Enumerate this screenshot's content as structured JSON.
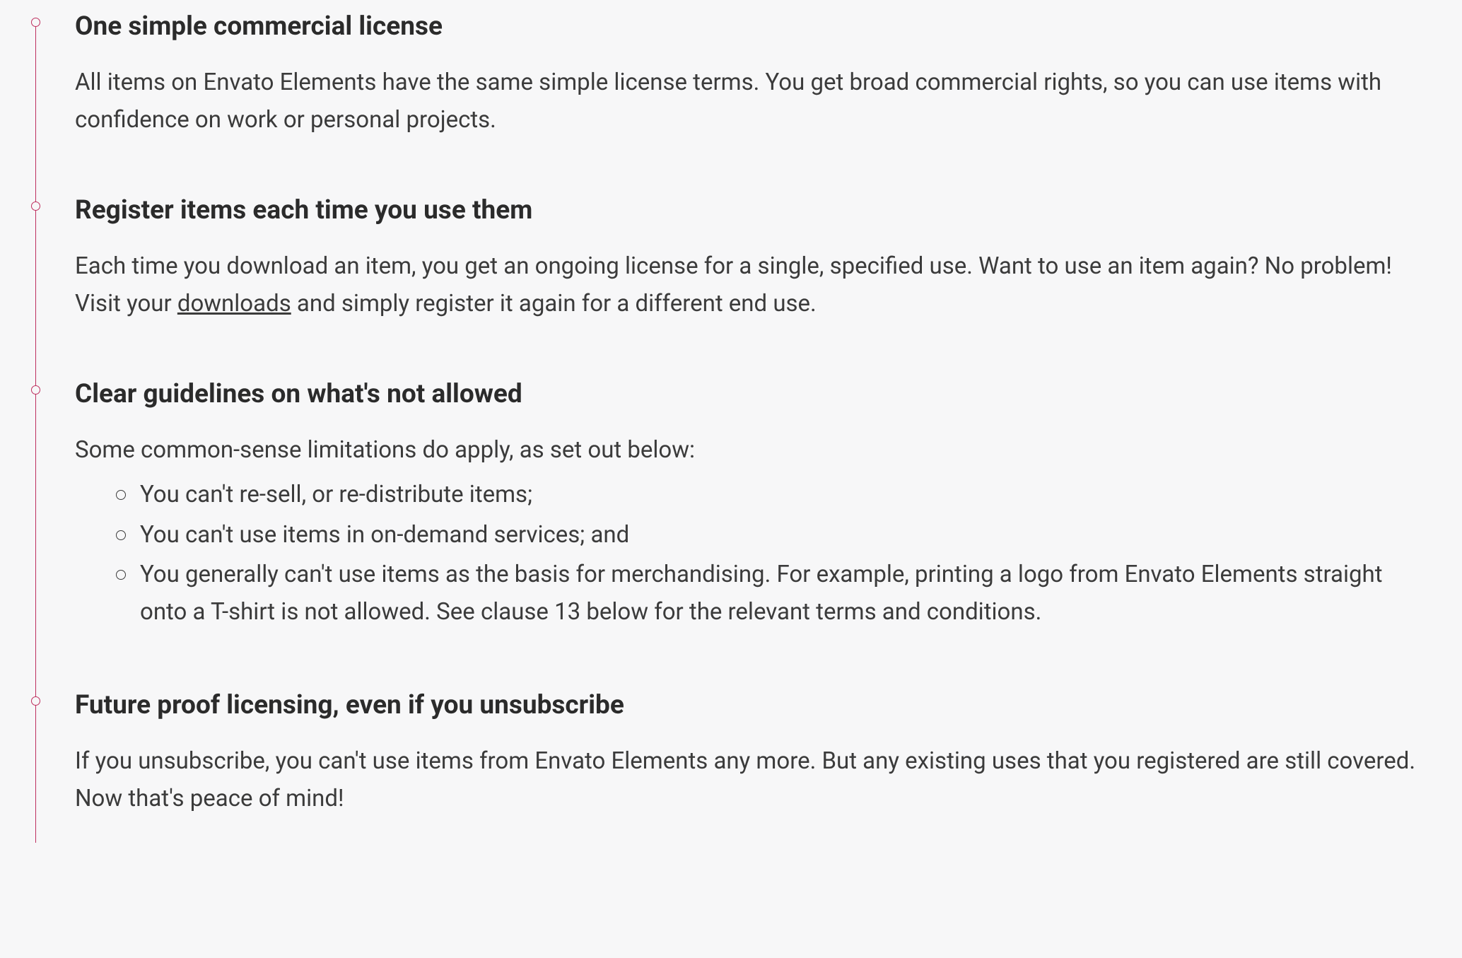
{
  "sections": [
    {
      "heading": "One simple commercial license",
      "body": "All items on Envato Elements have the same simple license terms. You get broad commercial rights, so you can use items with confidence on work or personal projects."
    },
    {
      "heading": "Register items each time you use them",
      "body_before_link": "Each time you download an item, you get an ongoing license for a single, specified use. Want to use an item again? No problem! Visit your ",
      "link_text": "downloads",
      "body_after_link": " and simply register it again for a different end use."
    },
    {
      "heading": "Clear guidelines on what's not allowed",
      "body": "Some common-sense limitations do apply, as set out below:",
      "bullets": [
        "You can't re-sell, or re-distribute items;",
        "You can't use items in on-demand services; and",
        "You generally can't use items as the basis for merchandising. For example, printing a logo from Envato Elements straight onto a T-shirt is not allowed. See clause 13 below for the relevant terms and conditions."
      ]
    },
    {
      "heading": "Future proof licensing, even if you unsubscribe",
      "body": "If you unsubscribe, you can't use items from Envato Elements any more. But any existing uses that you registered are still covered. Now that's peace of mind!"
    }
  ]
}
